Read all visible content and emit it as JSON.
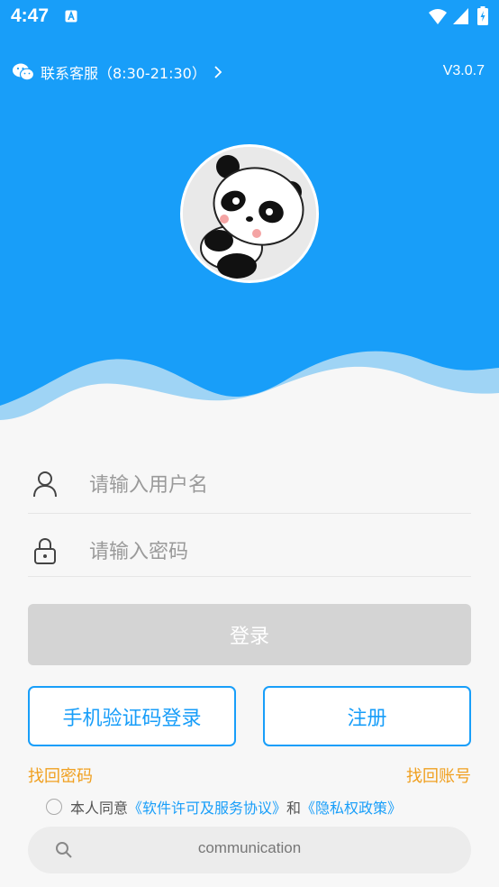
{
  "status_bar": {
    "time": "4:47"
  },
  "header": {
    "support_text": "联系客服（8:30-21:30）",
    "version": "V3.0.7"
  },
  "form": {
    "username_placeholder": "请输入用户名",
    "password_placeholder": "请输入密码",
    "login_label": "登录",
    "sms_login_label": "手机验证码登录",
    "register_label": "注册",
    "forgot_password": "找回密码",
    "forgot_account": "找回账号"
  },
  "agreement": {
    "prefix": "本人同意",
    "license": "《软件许可及服务协议》",
    "and": "和",
    "privacy": "《隐私权政策》"
  },
  "search": {
    "text": "communication"
  },
  "colors": {
    "brand_blue": "#189ef9",
    "link_orange": "#f0a020",
    "disabled_gray": "#d4d4d4"
  }
}
